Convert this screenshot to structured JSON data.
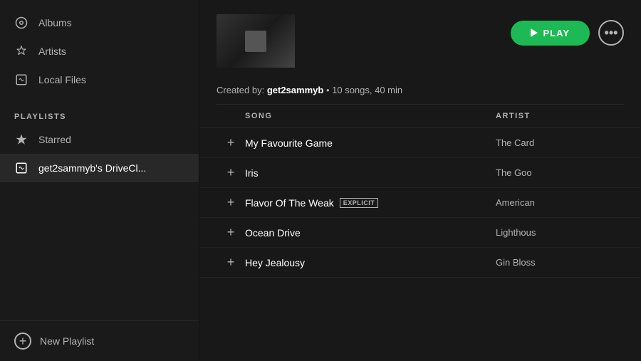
{
  "sidebar": {
    "nav_items": [
      {
        "id": "albums",
        "label": "Albums",
        "icon": "album-icon"
      },
      {
        "id": "artists",
        "label": "Artists",
        "icon": "artist-icon"
      },
      {
        "id": "local-files",
        "label": "Local Files",
        "icon": "local-files-icon"
      }
    ],
    "playlists_label": "PLAYLISTS",
    "starred_label": "Starred",
    "playlist_label": "get2sammyb's DriveCl...",
    "new_playlist_label": "New Playlist"
  },
  "header": {
    "play_label": "PLAY",
    "more_label": "...",
    "meta_text": "Created by:",
    "meta_creator": "get2sammyb",
    "meta_dot": "•",
    "meta_songs": "10 songs, 40 min"
  },
  "song_list": {
    "col_song": "SONG",
    "col_artist": "ARTIST",
    "songs": [
      {
        "title": "My Favourite Game",
        "artist": "The Card",
        "explicit": false
      },
      {
        "title": "Iris",
        "artist": "The Goo",
        "explicit": false
      },
      {
        "title": "Flavor Of The Weak",
        "artist": "American",
        "explicit": true
      },
      {
        "title": "Ocean Drive",
        "artist": "Lighthous",
        "explicit": false
      },
      {
        "title": "Hey Jealousy",
        "artist": "Gin Bloss",
        "explicit": false
      }
    ],
    "explicit_label": "EXPLICIT",
    "add_symbol": "+"
  },
  "colors": {
    "accent": "#1db954",
    "sidebar_bg": "#1a1a1a",
    "main_bg": "#181818",
    "row_hover": "#282828"
  }
}
